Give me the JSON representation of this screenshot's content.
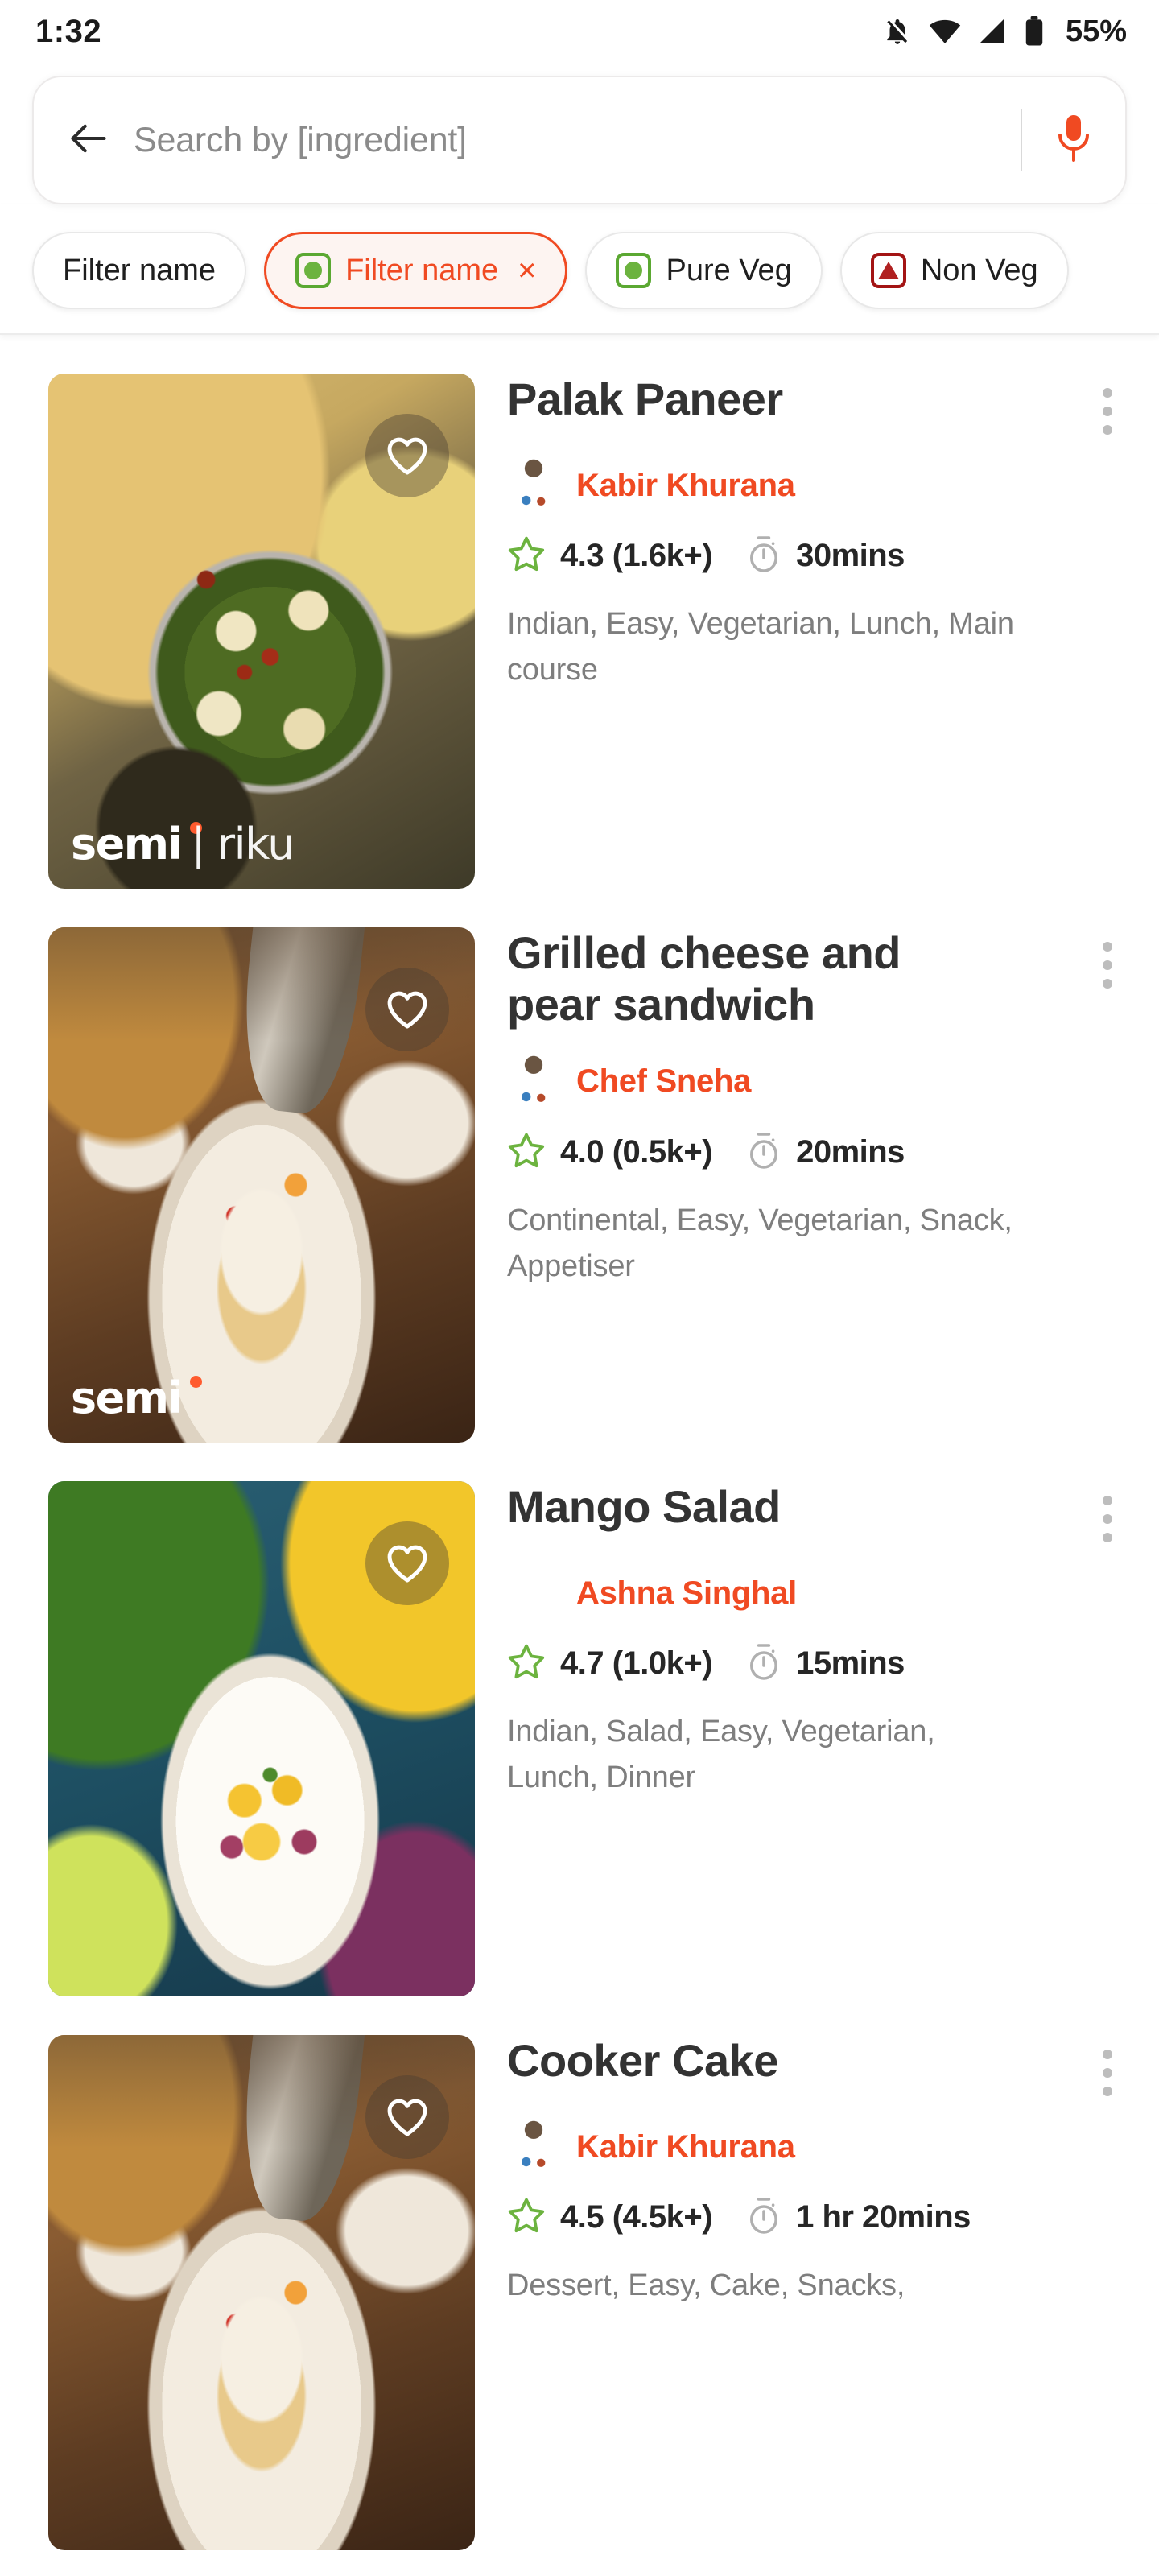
{
  "statusbar": {
    "time": "1:32",
    "battery": "55%",
    "icons": [
      "notifications-off-icon",
      "wifi-icon",
      "cellular-signal-icon",
      "battery-icon"
    ]
  },
  "search": {
    "placeholder": "Search by [ingredient]",
    "value": "",
    "back_icon": "back-arrow-icon",
    "mic_icon": "microphone-icon",
    "mic_color": "#f04a22"
  },
  "filters": [
    {
      "label": "Filter name",
      "selected": false,
      "mark": "none",
      "removable": false
    },
    {
      "label": "Filter name",
      "selected": true,
      "mark": "veg",
      "removable": true,
      "close": "×"
    },
    {
      "label": "Pure Veg",
      "selected": false,
      "mark": "veg",
      "removable": false
    },
    {
      "label": "Non Veg",
      "selected": false,
      "mark": "nonveg",
      "removable": false
    }
  ],
  "colors": {
    "accent": "#f04a22",
    "veg_green": "#5ba832",
    "nonveg_red": "#a31414",
    "star_green": "#6cb33f",
    "tag_gray": "#7e7e7e",
    "title_gray": "#333333"
  },
  "recipes": [
    {
      "title": "Palak Paneer",
      "author": "Kabir Khurana",
      "avatar_type": "photo",
      "rating": "4.3 (1.6k+)",
      "time": "30mins",
      "tags": "Indian, Easy, Vegetarian, Lunch, Main course",
      "watermark": "semi",
      "watermark_suffix": "| riku",
      "image": "palak-paneer-photo",
      "favorite_icon": "heart-outline-icon",
      "menu_icon": "kebab-menu-icon",
      "star_icon": "star-outline-icon",
      "timer_icon": "stopwatch-icon"
    },
    {
      "title": "Grilled cheese and pear sandwich",
      "author": "Chef Sneha",
      "avatar_type": "photo",
      "rating": "4.0 (0.5k+)",
      "time": "20mins",
      "tags": "Continental, Easy, Vegetarian, Snack, Appetiser",
      "watermark": "semi",
      "watermark_suffix": "",
      "image": "grilled-cheese-photo",
      "favorite_icon": "heart-outline-icon",
      "menu_icon": "kebab-menu-icon",
      "star_icon": "star-outline-icon",
      "timer_icon": "stopwatch-icon"
    },
    {
      "title": "Mango Salad",
      "author": "Ashna Singhal",
      "avatar_type": "cartoon",
      "rating": "4.7 (1.0k+)",
      "time": "15mins",
      "tags": "Indian, Salad, Easy, Vegetarian, Lunch, Dinner",
      "watermark": "",
      "watermark_suffix": "",
      "image": "mango-salad-photo",
      "favorite_icon": "heart-outline-icon",
      "menu_icon": "kebab-menu-icon",
      "star_icon": "star-outline-icon",
      "timer_icon": "stopwatch-icon"
    },
    {
      "title": "Cooker Cake",
      "author": "Kabir Khurana",
      "avatar_type": "photo",
      "rating": "4.5 (4.5k+)",
      "time": "1 hr 20mins",
      "tags": "Dessert, Easy, Cake, Snacks,",
      "watermark": "",
      "watermark_suffix": "",
      "image": "grilled-cheese-photo",
      "favorite_icon": "heart-outline-icon",
      "menu_icon": "kebab-menu-icon",
      "star_icon": "star-outline-icon",
      "timer_icon": "stopwatch-icon"
    }
  ]
}
